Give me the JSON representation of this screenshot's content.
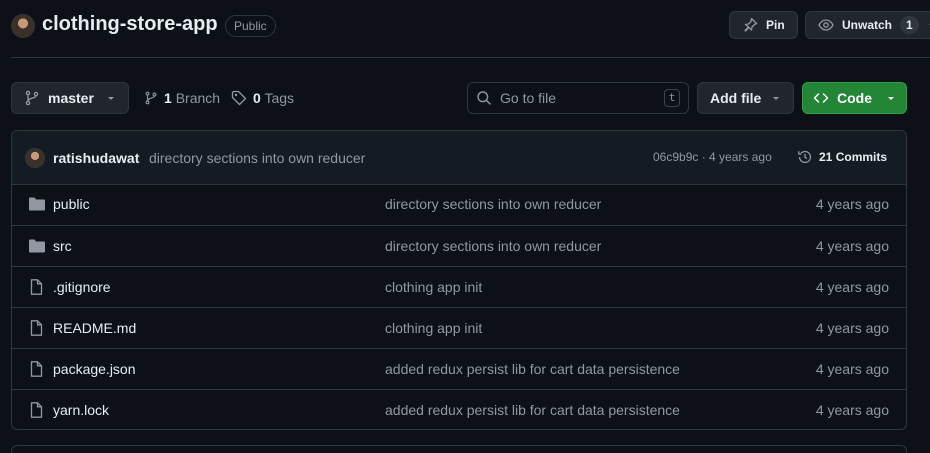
{
  "repo": {
    "name": "clothing-store-app",
    "visibility": "Public"
  },
  "header_actions": {
    "pin_label": "Pin",
    "watch_label": "Unwatch",
    "watch_count": "1"
  },
  "toolbar": {
    "branch_name": "master",
    "branch_count": "1",
    "branch_label": "Branch",
    "tag_count": "0",
    "tag_label": "Tags",
    "search_placeholder": "Go to file",
    "search_shortcut": "t",
    "add_file_label": "Add file",
    "code_label": "Code"
  },
  "latest_commit": {
    "author": "ratishudawat",
    "message": "directory sections into own reducer",
    "sha_time": "06c9b9c · 4 years ago",
    "commits_count": "21",
    "commits_label": "Commits"
  },
  "files": [
    {
      "name": "public",
      "type": "folder",
      "message": "directory sections into own reducer",
      "age": "4 years ago"
    },
    {
      "name": "src",
      "type": "folder",
      "message": "directory sections into own reducer",
      "age": "4 years ago"
    },
    {
      "name": ".gitignore",
      "type": "file",
      "message": "clothing app init",
      "age": "4 years ago"
    },
    {
      "name": "README.md",
      "type": "file",
      "message": "clothing app init",
      "age": "4 years ago"
    },
    {
      "name": "package.json",
      "type": "file",
      "message": "added redux persist lib for cart data persistence",
      "age": "4 years ago"
    },
    {
      "name": "yarn.lock",
      "type": "file",
      "message": "added redux persist lib for cart data persistence",
      "age": "4 years ago"
    }
  ],
  "colors": {
    "background": "#0d1117",
    "border": "#30363d",
    "muted_text": "#9198a1",
    "code_button": "#238636"
  }
}
